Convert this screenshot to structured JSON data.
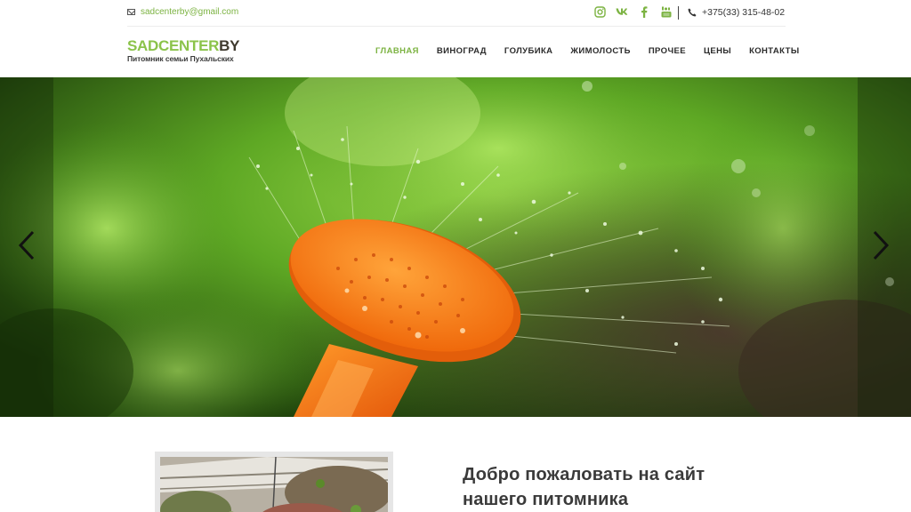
{
  "topbar": {
    "email": "sadcenterby@gmail.com",
    "phone": "+375(33) 315-48-02",
    "social": [
      "instagram-icon",
      "vk-icon",
      "facebook-icon",
      "youtube-icon"
    ]
  },
  "logo": {
    "brand_part1": "SADCENTER",
    "brand_part2": "BY",
    "tagline": "Питомник семьи Пухальских"
  },
  "nav": {
    "items": [
      {
        "label": "ГЛАВНАЯ",
        "active": true
      },
      {
        "label": "ВИНОГРАД",
        "active": false
      },
      {
        "label": "ГОЛУБИКА",
        "active": false
      },
      {
        "label": "ЖИМОЛОСТЬ",
        "active": false
      },
      {
        "label": "ПРОЧЕЕ",
        "active": false
      },
      {
        "label": "ЦЕНЫ",
        "active": false
      },
      {
        "label": "КОНТАКТЫ",
        "active": false
      }
    ]
  },
  "hero": {
    "arrow_left": "prev-arrow-icon",
    "arrow_right": "next-arrow-icon"
  },
  "welcome": {
    "title_line1": "Добро пожаловать на сайт",
    "title_line2": "нашего питомника"
  },
  "colors": {
    "accent": "#7cb342",
    "text": "#2b2b2b",
    "logo_dark": "#3f3a2e"
  }
}
